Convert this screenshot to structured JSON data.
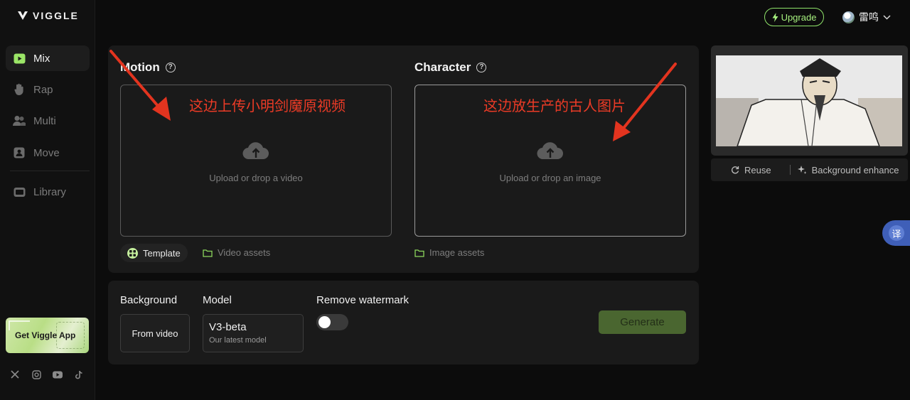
{
  "app": {
    "logo_text": "VIGGLE"
  },
  "sidebar": {
    "items": [
      {
        "label": "Mix",
        "icon": "play-square-icon",
        "active": true
      },
      {
        "label": "Rap",
        "icon": "hand-icon",
        "active": false
      },
      {
        "label": "Multi",
        "icon": "users-icon",
        "active": false
      },
      {
        "label": "Move",
        "icon": "person-box-icon",
        "active": false
      },
      {
        "label": "Library",
        "icon": "film-icon",
        "active": false
      }
    ],
    "app_card": "Get Viggle App",
    "socials": [
      "x-icon",
      "instagram-icon",
      "youtube-icon",
      "tiktok-icon"
    ]
  },
  "header": {
    "upgrade": "Upgrade",
    "user_name": "雷鸣"
  },
  "motion": {
    "title": "Motion",
    "drop_label": "Upload or drop a video",
    "annotation": "这边上传小明剑魔原视频",
    "template_label": "Template",
    "assets_label": "Video assets"
  },
  "character": {
    "title": "Character",
    "drop_label": "Upload or drop an image",
    "annotation": "这边放生产的古人图片",
    "assets_label": "Image assets"
  },
  "settings": {
    "background_label": "Background",
    "background_value": "From video",
    "model_label": "Model",
    "model_name": "V3-beta",
    "model_sub": "Our latest model",
    "watermark_label": "Remove watermark",
    "watermark_on": false,
    "generate": "Generate"
  },
  "preview": {
    "reuse": "Reuse",
    "enhance": "Background enhance"
  },
  "translate_glyph": "译",
  "colors": {
    "accent": "#a6f07e",
    "annotation": "#ec3b26",
    "generate_bg": "#4a6630"
  }
}
